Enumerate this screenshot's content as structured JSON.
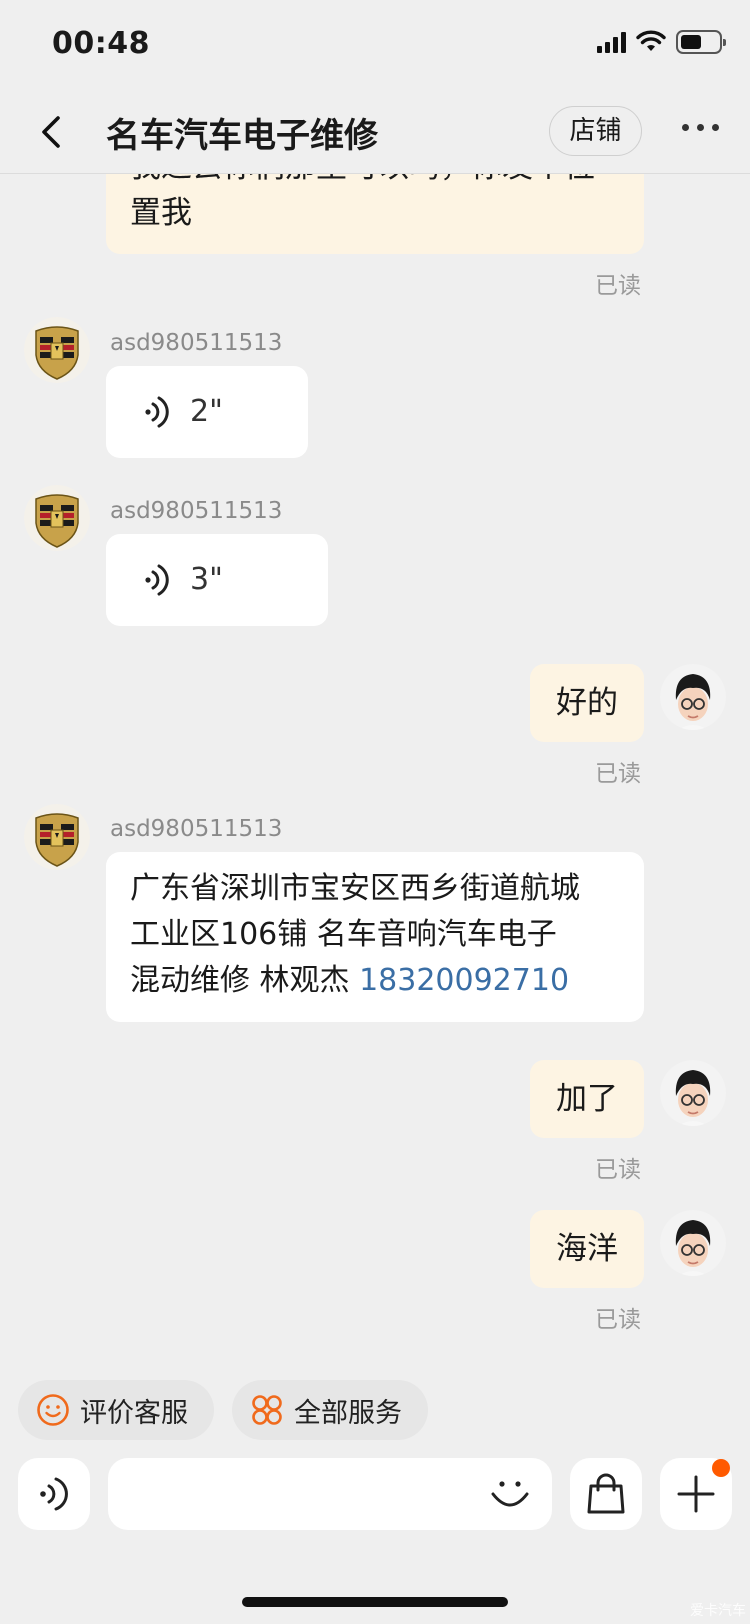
{
  "status_bar": {
    "time": "00:48"
  },
  "header": {
    "title": "名车汽车电子维修",
    "shop_button": "店铺"
  },
  "messages": {
    "m0": {
      "text_line1": "我过去你们那里可以吗，你发个位",
      "text_line2": "置我",
      "read": "已读"
    },
    "m1": {
      "sender": "asd980511513",
      "duration": "2\""
    },
    "m2": {
      "sender": "asd980511513",
      "duration": "3\""
    },
    "m3": {
      "text": "好的",
      "read": "已读"
    },
    "m4": {
      "sender": "asd980511513",
      "line1": "广东省深圳市宝安区西乡街道航城",
      "line2": "工业区106铺 名车音响汽车电子",
      "line3_prefix": "混动维修 林观杰 ",
      "phone": "18320092710"
    },
    "m5": {
      "text": "加了",
      "read": "已读"
    },
    "m6": {
      "text": "海洋",
      "read": "已读"
    }
  },
  "quick_actions": {
    "rate": "评价客服",
    "services": "全部服务"
  },
  "watermark": "爱卡汽车",
  "colors": {
    "accent": "#ff5a00",
    "mine_bubble": "#fdf4e3",
    "link": "#3a6ea5"
  }
}
